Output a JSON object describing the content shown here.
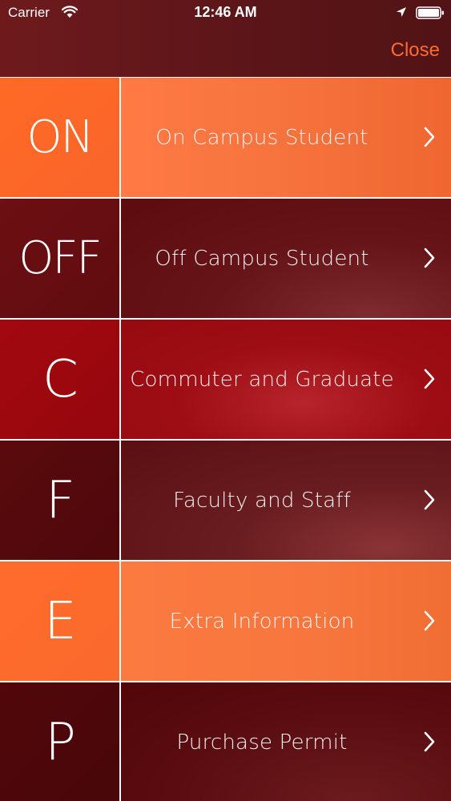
{
  "status_bar": {
    "carrier": "Carrier",
    "time": "12:46 AM",
    "icons": [
      "wifi-icon",
      "location-icon",
      "battery-icon"
    ]
  },
  "nav": {
    "close_label": "Close"
  },
  "colors": {
    "accent": "#ff6a2e",
    "header_bg": "#5e1719",
    "orange": "#ff6a26",
    "maroon": "#6d0f13",
    "red": "#a2080f",
    "dark_maroon": "#520709"
  },
  "menu": {
    "items": [
      {
        "abbr": "ON",
        "label": "On Campus Student",
        "icon": "chevron-right-icon"
      },
      {
        "abbr": "OFF",
        "label": "Off Campus Student",
        "icon": "chevron-right-icon"
      },
      {
        "abbr": "C",
        "label": "Commuter and Graduate",
        "icon": "chevron-right-icon"
      },
      {
        "abbr": "F",
        "label": "Faculty and Staff",
        "icon": "chevron-right-icon"
      },
      {
        "abbr": "E",
        "label": "Extra Information",
        "icon": "chevron-right-icon"
      },
      {
        "abbr": "P",
        "label": "Purchase Permit",
        "icon": "chevron-right-icon"
      }
    ]
  }
}
